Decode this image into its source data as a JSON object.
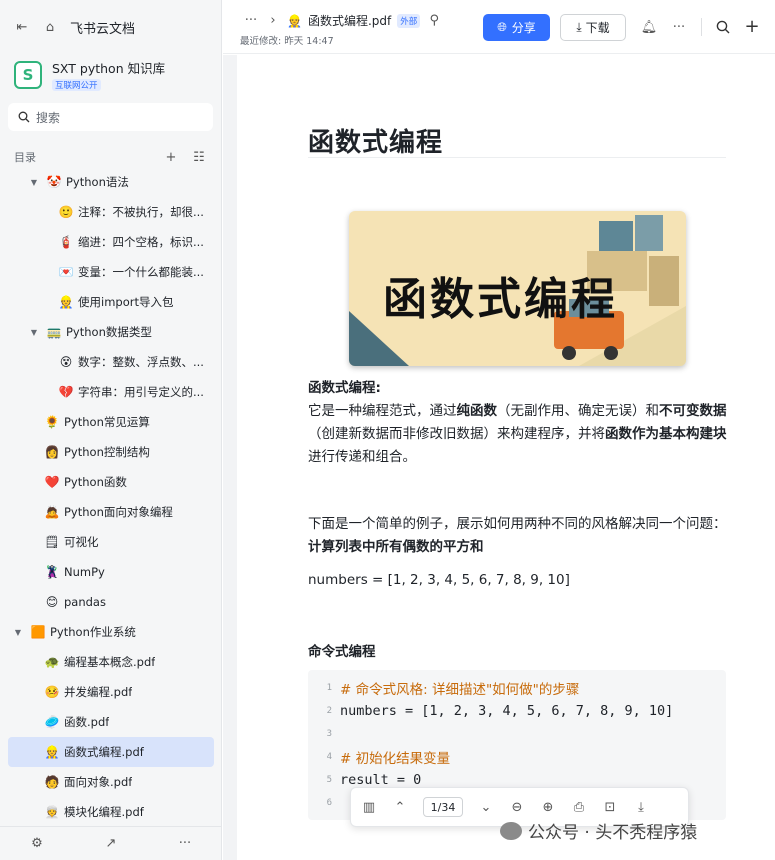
{
  "app": {
    "name": "飞书云文档"
  },
  "kb": {
    "logo_letter": "S",
    "name": "SXT python 知识库",
    "badge": "互联网公开"
  },
  "search": {
    "placeholder": "搜索"
  },
  "toc": {
    "label": "目录"
  },
  "tree": [
    {
      "label": "Python语法",
      "icon": "🤡",
      "level": "l1",
      "arrow": "▼"
    },
    {
      "label": "注释：不被执行，却很...",
      "icon": "🙂",
      "level": "l2"
    },
    {
      "label": "缩进：四个空格，标识...",
      "icon": "🧯",
      "level": "l2"
    },
    {
      "label": "变量：一个什么都能装...",
      "icon": "💌",
      "level": "l2"
    },
    {
      "label": "使用import导入包",
      "icon": "👷",
      "level": "l2"
    },
    {
      "label": "Python数据类型",
      "icon": "🚃",
      "level": "l1",
      "arrow": "▼"
    },
    {
      "label": "数字：整数、浮点数、...",
      "icon": "😵",
      "level": "l2"
    },
    {
      "label": "字符串：用引号定义的...",
      "icon": "💔",
      "level": "l2"
    },
    {
      "label": "Python常见运算",
      "icon": "🌻",
      "level": "l1n"
    },
    {
      "label": "Python控制结构",
      "icon": "👩",
      "level": "l1n"
    },
    {
      "label": "Python函数",
      "icon": "❤️",
      "level": "l1n"
    },
    {
      "label": "Python面向对象编程",
      "icon": "🙇",
      "level": "l1n"
    },
    {
      "label": "可视化",
      "icon": "🗒",
      "level": "l1n"
    },
    {
      "label": "NumPy",
      "icon": "🦹",
      "level": "l1n"
    },
    {
      "label": "pandas",
      "icon": "😊",
      "level": "l1n"
    },
    {
      "label": "Python作业系统",
      "icon": "🟧",
      "level": "l0",
      "arrow": "▼"
    },
    {
      "label": "编程基本概念.pdf",
      "icon": "🐢",
      "level": "l1n"
    },
    {
      "label": "并发编程.pdf",
      "icon": "🤒",
      "level": "l1n"
    },
    {
      "label": "函数.pdf",
      "icon": "🥏",
      "level": "l1n"
    },
    {
      "label": "函数式编程.pdf",
      "icon": "👷",
      "level": "l1n",
      "selected": true
    },
    {
      "label": "面向对象.pdf",
      "icon": "🧑",
      "level": "l1n"
    },
    {
      "label": "模块化编程.pdf",
      "icon": "👳",
      "level": "l1n"
    }
  ],
  "header": {
    "breadcrumb_icon": "👷",
    "title": "函数式编程.pdf",
    "tag": "外部",
    "modified": "最近修改: 昨天 14:47",
    "share_label": "分享",
    "download_label": "下载"
  },
  "doc": {
    "heading": "函数式编程",
    "banner_text": "函数式编程",
    "p1_title": "函数式编程:",
    "p1_a": "它是一种编程范式，通过",
    "p1_b": "纯函数",
    "p1_c": "（无副作用、确定无误）和",
    "p1_d": "不可变数据",
    "p1_e": "（创建新数据而非修改旧数据）来构建程序，并将",
    "p1_f": "函数作为基本构建块",
    "p1_g": "进行传递和组合。",
    "p2_a": "下面是一个简单的例子，展示如何用两种不同的风格解决同一个问题：",
    "p2_b": "计算列表中所有偶数的平方和",
    "p3": "numbers = [1, 2, 3, 4, 5, 6, 7, 8, 9, 10]",
    "section": "命令式编程",
    "code": [
      {
        "ln": "1",
        "text": "# 命令式风格: 详细描述\"如何做\"的步骤",
        "kind": "comment"
      },
      {
        "ln": "2",
        "text": "numbers = [1, 2, 3, 4, 5, 6, 7, 8, 9, 10]",
        "kind": "code"
      },
      {
        "ln": "3",
        "text": "",
        "kind": "code"
      },
      {
        "ln": "4",
        "text": "# 初始化结果变量",
        "kind": "comment"
      },
      {
        "ln": "5",
        "text": "result = 0",
        "kind": "code"
      },
      {
        "ln": "6",
        "text": "",
        "kind": "code"
      }
    ]
  },
  "pdf_toolbar": {
    "page": "1/34"
  },
  "watermark": "公众号 · 头不秃程序猿"
}
